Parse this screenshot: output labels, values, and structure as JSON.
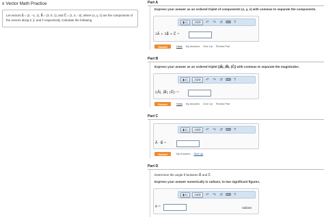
{
  "app": {
    "title": "± Vector Math Practice"
  },
  "intro": {
    "text": "Let vectors A⃗ = (2, −1, 1), B⃗ = (3, 0, 1), and C⃗ = (1, 4, −2), where (x, y, z) are the components of the vectors along x̂, ŷ, and ẑ respectively. Calculate the following."
  },
  "toolbar": {
    "template_label": "▮√▯",
    "symbol_label": "ΑΣΦ",
    "undo": "↶",
    "redo": "↷",
    "reset": "↺",
    "keyboard": "⌨",
    "help": "?"
  },
  "actions": {
    "submit": "Submit",
    "hints": "Hints",
    "my_answers": "My Answers",
    "give_up": "Give Up",
    "review_part": "Review Part"
  },
  "parts": [
    {
      "label": "Part A",
      "instruction": "Express your answer as an ordered triplet of components (x, y, z) with commas to separate the components.",
      "expression": "2A⃗ + 3B⃗ + C⃗ ="
    },
    {
      "label": "Part B",
      "instruction": "Express your answer as an ordered triplet (|A⃗|, |B⃗|, |C⃗|) with commas to separate the magnitudes.",
      "expression": "(|A⃗|, |B⃗|, |C⃗|) ="
    },
    {
      "label": "Part C",
      "expression": "A⃗ · B⃗ ="
    },
    {
      "label": "Part D",
      "prompt": "Determine the angle θ between B⃗ and C⃗.",
      "instruction": "Express your answer numerically in radians, to two significant figures.",
      "expression": "θ =",
      "unit": "radians"
    }
  ]
}
